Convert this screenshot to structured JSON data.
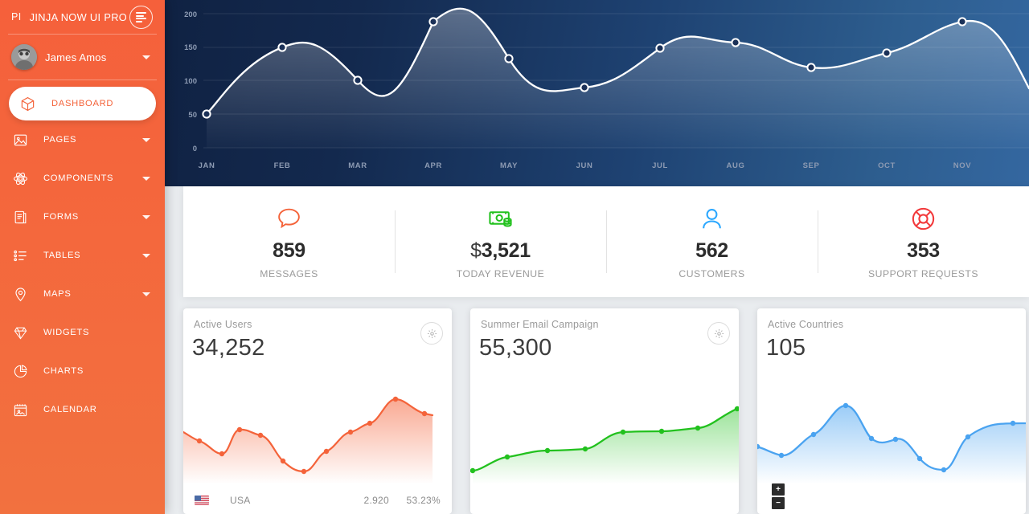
{
  "brand": {
    "mini": "PI",
    "text": "JINJA NOW UI PRO",
    "toggle_icon": "hamburger-icon"
  },
  "user": {
    "name": "James Amos",
    "avatar_icon": "user-avatar",
    "caret_icon": "chevron-down-icon"
  },
  "sidebar": {
    "items": [
      {
        "label": "DASHBOARD",
        "icon": "cube-icon",
        "active": true,
        "caret": false
      },
      {
        "label": "PAGES",
        "icon": "image-icon",
        "active": false,
        "caret": true
      },
      {
        "label": "COMPONENTS",
        "icon": "atom-icon",
        "active": false,
        "caret": true
      },
      {
        "label": "FORMS",
        "icon": "document-icon",
        "active": false,
        "caret": true
      },
      {
        "label": "TABLES",
        "icon": "list-icon",
        "active": false,
        "caret": true
      },
      {
        "label": "MAPS",
        "icon": "pin-icon",
        "active": false,
        "caret": true
      },
      {
        "label": "WIDGETS",
        "icon": "diamond-icon",
        "active": false,
        "caret": false
      },
      {
        "label": "CHARTS",
        "icon": "pie-icon",
        "active": false,
        "caret": false
      },
      {
        "label": "CALENDAR",
        "icon": "calendar-icon",
        "active": false,
        "caret": false
      }
    ]
  },
  "colors": {
    "brand_orange": "#f4633a",
    "chart_dark": "#102243",
    "chart_light": "#3467a0",
    "green": "#22c11e",
    "blue": "#4aa3f0",
    "red": "#f2383a",
    "page_bg": "#e9ecef"
  },
  "chart_data": {
    "type": "area",
    "title": "",
    "xlabel": "",
    "ylabel": "",
    "grid": true,
    "legend": "none",
    "ylim": [
      0,
      200
    ],
    "yticks": [
      0,
      50,
      100,
      150,
      200
    ],
    "categories": [
      "JAN",
      "FEB",
      "MAR",
      "APR",
      "MAY",
      "JUN",
      "JUL",
      "AUG",
      "SEP",
      "OCT",
      "NOV"
    ],
    "values": [
      50,
      150,
      100,
      190,
      130,
      90,
      150,
      155,
      120,
      140,
      190
    ]
  },
  "stats": {
    "items": [
      {
        "icon": "chat-bubble-icon",
        "value": "859",
        "currency": "",
        "label": "MESSAGES",
        "color": "#f4633a"
      },
      {
        "icon": "money-icon",
        "value": "3,521",
        "currency": "$",
        "label": "TODAY REVENUE",
        "color": "#22c11e"
      },
      {
        "icon": "user-icon",
        "value": "562",
        "currency": "",
        "label": "CUSTOMERS",
        "color": "#2ca8ff"
      },
      {
        "icon": "lifering-icon",
        "value": "353",
        "currency": "",
        "label": "SUPPORT REQUESTS",
        "color": "#f2383a"
      }
    ]
  },
  "cards": [
    {
      "title": "Active Users",
      "value": "34,252",
      "gear_icon": "gear-icon",
      "color": "#f4633a",
      "chart_data": {
        "type": "area",
        "title": "Active Users",
        "values": [
          44,
          36,
          26,
          46,
          41,
          30,
          14,
          24,
          48,
          56,
          60,
          74,
          62
        ],
        "ylim": [
          0,
          100
        ]
      },
      "footer": {
        "flag_icon": "flag-usa-icon",
        "name": "USA",
        "number": "2.920",
        "percent": "53.23%"
      }
    },
    {
      "title": "Summer Email Campaign",
      "value": "55,300",
      "gear_icon": "gear-icon",
      "color": "#22c11e",
      "chart_data": {
        "type": "area",
        "title": "Summer Email Campaign",
        "values": [
          4,
          22,
          30,
          31,
          44,
          48,
          48,
          49,
          64,
          72
        ],
        "ylim": [
          0,
          100
        ]
      },
      "footer": null
    },
    {
      "title": "Active Countries",
      "value": "105",
      "gear_icon": "gear-icon",
      "color": "#4aa3f0",
      "chart_data": {
        "type": "area",
        "title": "Active Countries",
        "values": [
          32,
          26,
          46,
          66,
          38,
          42,
          20,
          18,
          50,
          56,
          54
        ],
        "ylim": [
          0,
          100
        ]
      },
      "map_controls": {
        "zoom_in": "+",
        "zoom_out": "−"
      }
    }
  ]
}
